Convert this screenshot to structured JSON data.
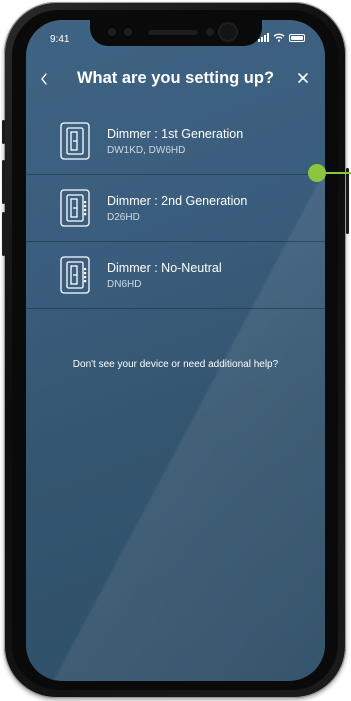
{
  "status_bar": {
    "time": "9:41"
  },
  "header": {
    "back_icon": "chevron-left-icon",
    "title": "What are you setting up?",
    "close_icon": "close-icon"
  },
  "devices": [
    {
      "name": "Dimmer : 1st Generation",
      "models": "DW1KD, DW6HD"
    },
    {
      "name": "Dimmer : 2nd Generation",
      "models": "D26HD"
    },
    {
      "name": "Dimmer : No-Neutral",
      "models": "DN6HD"
    }
  ],
  "help_text": "Don't see your device or need additional help?",
  "colors": {
    "screen_background": "#3a5d7d",
    "text": "#ffffff",
    "icon_stroke": "#ffffff",
    "marker": "#8cc63f"
  }
}
